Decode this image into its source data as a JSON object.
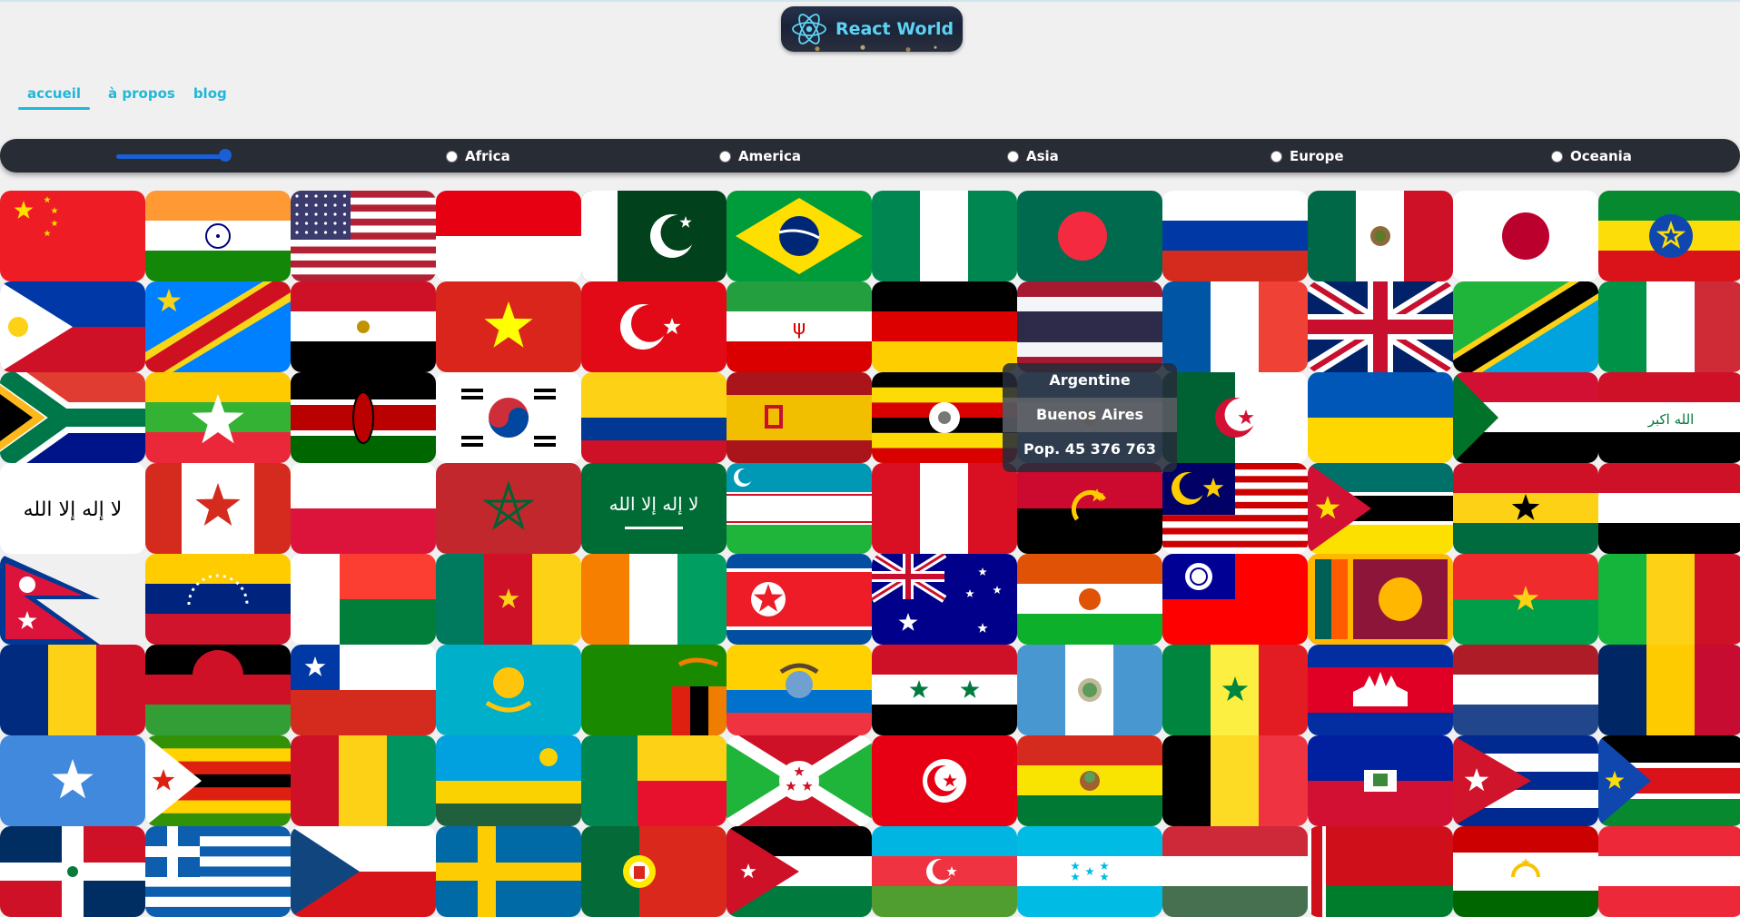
{
  "app": {
    "logo_text": "React World",
    "logo_icon": "react-atom-icon"
  },
  "nav": {
    "items": [
      {
        "label": "accueil",
        "active": true
      },
      {
        "label": "à propos",
        "active": false
      },
      {
        "label": "blog",
        "active": false
      }
    ]
  },
  "filters": {
    "range_slider": {
      "value_fraction": 0.98
    },
    "continents": [
      {
        "label": "Africa",
        "checked": false
      },
      {
        "label": "America",
        "checked": false
      },
      {
        "label": "Asia",
        "checked": false
      },
      {
        "label": "Europe",
        "checked": false
      },
      {
        "label": "Oceania",
        "checked": false
      }
    ]
  },
  "flags": [
    "china",
    "india",
    "united-states",
    "indonesia",
    "pakistan",
    "brazil",
    "nigeria",
    "bangladesh",
    "russia",
    "mexico",
    "japan",
    "ethiopia",
    "philippines",
    "dr-congo",
    "egypt",
    "vietnam",
    "turkey",
    "iran",
    "germany",
    "thailand",
    "france",
    "united-kingdom",
    "tanzania",
    "italy",
    "south-africa",
    "myanmar",
    "kenya",
    "south-korea",
    "colombia",
    "spain",
    "uganda",
    "argentina",
    "algeria",
    "ukraine",
    "sudan",
    "iraq",
    "afghanistan",
    "canada",
    "poland",
    "morocco",
    "saudi-arabia",
    "uzbekistan",
    "peru",
    "angola",
    "malaysia",
    "mozambique",
    "ghana",
    "yemen",
    "nepal",
    "venezuela",
    "madagascar",
    "cameroon",
    "ivory-coast",
    "north-korea",
    "australia",
    "niger",
    "taiwan",
    "sri-lanka",
    "burkina-faso",
    "mali",
    "romania",
    "malawi",
    "chile",
    "kazakhstan",
    "zambia",
    "ecuador",
    "syria",
    "guatemala",
    "senegal",
    "cambodia",
    "netherlands",
    "chad",
    "somalia",
    "zimbabwe",
    "guinea",
    "rwanda",
    "benin",
    "burundi",
    "tunisia",
    "bolivia",
    "belgium",
    "haiti",
    "cuba",
    "south-sudan",
    "dominican-republic",
    "greece",
    "czechia",
    "sweden",
    "portugal",
    "jordan",
    "azerbaijan",
    "honduras",
    "hungary",
    "belarus",
    "tajikistan",
    "austria"
  ],
  "tooltip": {
    "country": "Argentine",
    "capital": "Buenos Aires",
    "population": "Pop. 45 376 763"
  },
  "colors": {
    "accent": "#1fb8d8",
    "bar": "#282c34",
    "radio_accent": "#1a5fd6"
  }
}
